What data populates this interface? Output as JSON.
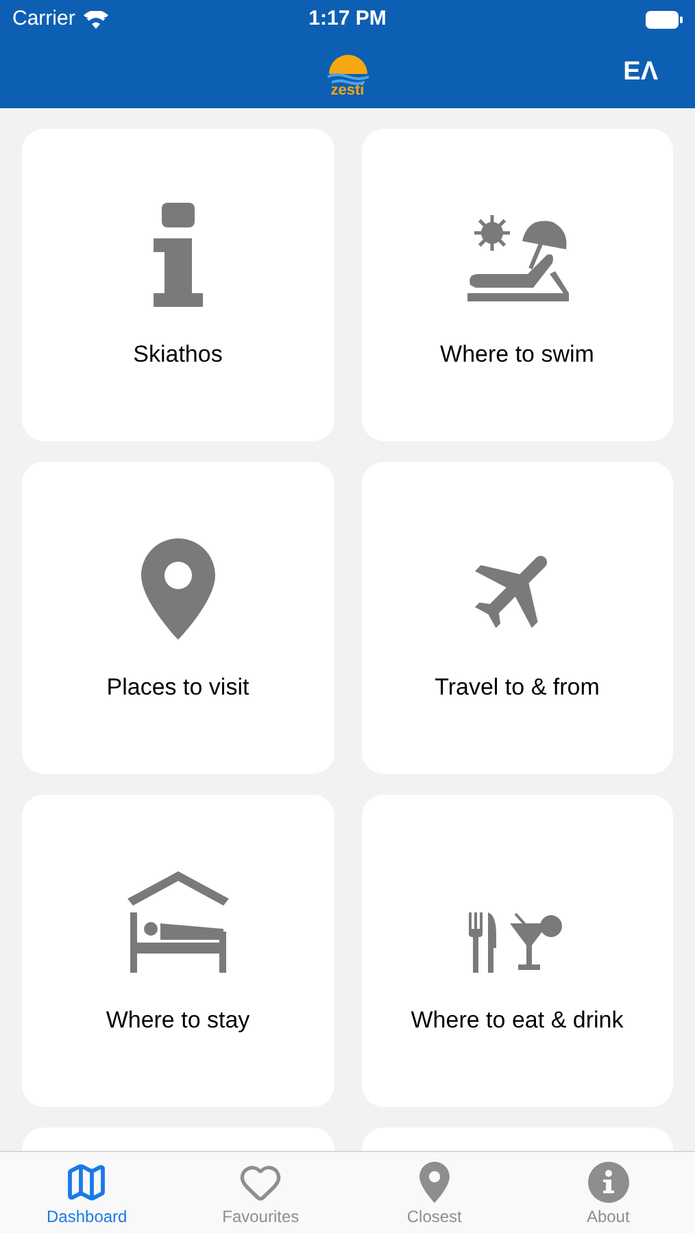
{
  "status_bar": {
    "carrier": "Carrier",
    "time": "1:17 PM"
  },
  "header": {
    "logo_text": "zesti",
    "language": "ΕΛ"
  },
  "cards": [
    {
      "kind": "info",
      "label": "Skiathos"
    },
    {
      "kind": "swim",
      "label": "Where to swim"
    },
    {
      "kind": "pin",
      "label": "Places to visit"
    },
    {
      "kind": "plane",
      "label": "Travel to & from"
    },
    {
      "kind": "stay",
      "label": "Where to stay"
    },
    {
      "kind": "eat",
      "label": "Where to eat & drink"
    }
  ],
  "tabs": [
    {
      "kind": "map",
      "label": "Dashboard",
      "selected": true
    },
    {
      "kind": "heart",
      "label": "Favourites",
      "selected": false
    },
    {
      "kind": "pin",
      "label": "Closest",
      "selected": false
    },
    {
      "kind": "info",
      "label": "About",
      "selected": false
    }
  ]
}
